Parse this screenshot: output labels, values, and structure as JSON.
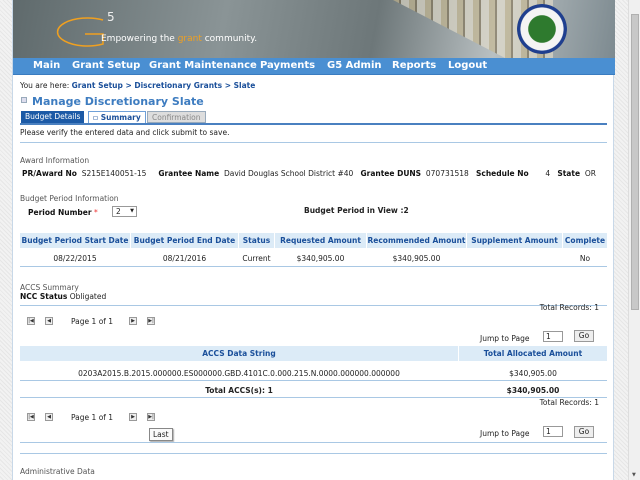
{
  "banner": {
    "logo": "G",
    "logo_sup": "5",
    "tagline_pre": "Empowering the ",
    "tagline_accent": "grant",
    "tagline_post": " community.",
    "seal": "department-of-education-seal",
    "accent": "#f0a020"
  },
  "nav": [
    "Main",
    "Grant Setup",
    "Grant Maintenance",
    "Payments",
    "G5 Admin",
    "Reports",
    "Logout"
  ],
  "breadcrumb": {
    "prefix": "You are here: ",
    "path": "Grant Setup > Discretionary Grants > Slate"
  },
  "page_title": "Manage Discretionary Slate",
  "tabs": [
    {
      "label": "Budget Details",
      "state": "completed"
    },
    {
      "label": "Summary",
      "state": "active"
    },
    {
      "label": "Confirmation",
      "state": "disabled"
    }
  ],
  "instruction": "Please verify the entered data and click submit to save.",
  "award": {
    "section": "Award Information",
    "pr_label": "PR/Award No",
    "pr": "S215E140051-15",
    "grantee_label": "Grantee Name",
    "grantee": "David Douglas School District #40",
    "duns_label": "Grantee DUNS",
    "duns": "070731518",
    "schedule_label": "Schedule No",
    "schedule": "4",
    "state_label": "State",
    "state": "OR"
  },
  "budget": {
    "section": "Budget Period Information",
    "period_label": "Period Number",
    "required": "*",
    "period_value": "2",
    "in_view": "Budget Period in View :2",
    "headers": [
      "Budget Period Start Date",
      "Budget Period End Date",
      "Status",
      "Requested Amount",
      "Recommended Amount",
      "Supplement Amount",
      "Complete"
    ],
    "row": [
      "08/22/2015",
      "08/21/2016",
      "Current",
      "$340,905.00",
      "$340,905.00",
      "",
      "No"
    ]
  },
  "accs": {
    "section": "ACCS Summary",
    "ncc_label": "NCC Status",
    "ncc": "Obligated",
    "total_records": "Total Records: 1",
    "page_text": "Page 1 of 1",
    "jump_label": "Jump to Page",
    "jump_value": "1",
    "go": "Go",
    "headers": [
      "ACCS Data String",
      "Total Allocated Amount"
    ],
    "row": [
      "0203A2015.B.2015.000000.ES000000.GBD.4101C.0.000.215.N.0000.000000.000000",
      "$340,905.00"
    ],
    "total_label": "Total ACCS(s): 1",
    "total_amount": "$340,905.00",
    "tooltip": "Last"
  },
  "admin": {
    "section": "Administrative Data"
  }
}
